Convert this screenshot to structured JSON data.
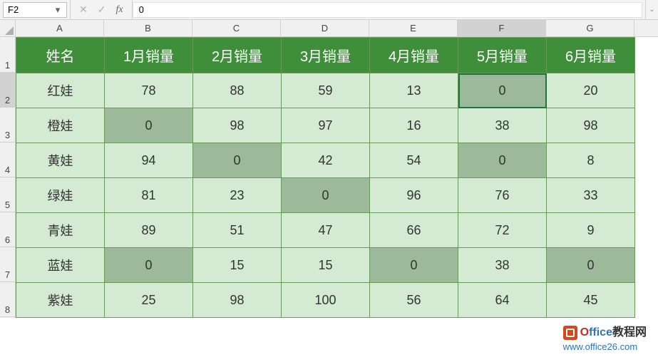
{
  "name_box": "F2",
  "formula_value": "0",
  "columns": [
    "A",
    "B",
    "C",
    "D",
    "E",
    "F",
    "G"
  ],
  "active_col_index": 5,
  "row_labels": [
    "1",
    "2",
    "3",
    "4",
    "5",
    "6",
    "7",
    "8"
  ],
  "active_row_index": 1,
  "active_cell": {
    "row": 0,
    "col": 5
  },
  "headers": [
    "姓名",
    "1月销量",
    "2月销量",
    "3月销量",
    "4月销量",
    "5月销量",
    "6月销量"
  ],
  "rows": [
    {
      "name": "红娃",
      "vals": [
        78,
        88,
        59,
        13,
        0,
        20
      ]
    },
    {
      "name": "橙娃",
      "vals": [
        0,
        98,
        97,
        16,
        38,
        98
      ]
    },
    {
      "name": "黄娃",
      "vals": [
        94,
        0,
        42,
        54,
        0,
        8
      ]
    },
    {
      "name": "绿娃",
      "vals": [
        81,
        23,
        0,
        96,
        76,
        33
      ]
    },
    {
      "name": "青娃",
      "vals": [
        89,
        51,
        47,
        66,
        72,
        9
      ]
    },
    {
      "name": "蓝娃",
      "vals": [
        0,
        15,
        15,
        0,
        38,
        0
      ]
    },
    {
      "name": "紫娃",
      "vals": [
        25,
        98,
        100,
        56,
        64,
        45
      ]
    }
  ],
  "watermark": {
    "brand_pre": "O",
    "brand_mid": "ffice",
    "brand_suf": "教程网",
    "url": "www.office26.com"
  }
}
